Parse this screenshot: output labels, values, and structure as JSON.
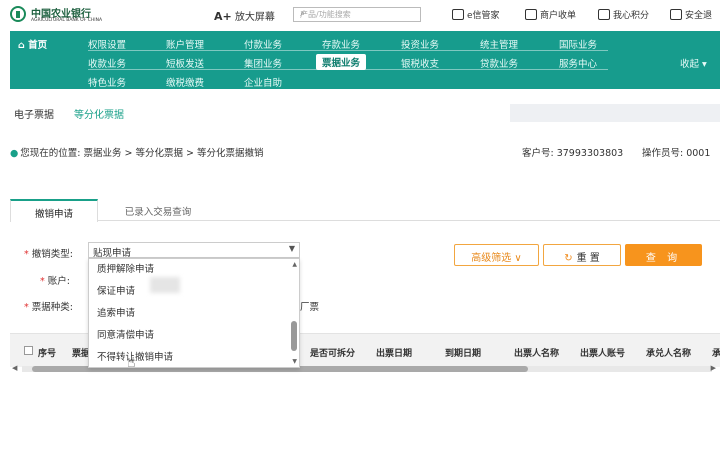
{
  "header": {
    "logo_cn": "中国农业银行",
    "logo_en": "AGRICULTURAL BANK OF CHINA",
    "zoom_prefix": "A+",
    "zoom_label": "放大屏幕",
    "search_placeholder": "产品/功能搜索",
    "links": [
      "e信管家",
      "商户收单",
      "我心积分",
      "安全退"
    ]
  },
  "nav": {
    "home": "首页",
    "row1": [
      "权限设置",
      "账户管理",
      "付款业务",
      "存款业务",
      "投资业务",
      "统主管理",
      "国际业务"
    ],
    "row2": [
      "收款业务",
      "短板发送",
      "集团业务",
      "票据业务",
      "银税收支",
      "贷款业务",
      "服务中心"
    ],
    "row3": [
      "特色业务",
      "缴税缴费",
      "企业自助"
    ],
    "right_label": "收起",
    "active": "票据业务"
  },
  "subnav": {
    "item1": "电子票据",
    "item2": "等分化票据"
  },
  "breadcrumb": "您现在的位置: 票据业务 > 等分化票据 > 等分化票据撤销",
  "customer_label": "客户号: 37993303803",
  "operator_label": "操作员号: 0001",
  "tabs": {
    "active": "撤销申请",
    "other": "已录入交易查询"
  },
  "form": {
    "req_mark": "*",
    "type_label": "撤销类型:",
    "account_label": "账户:",
    "bill_type_label": "票据种类:",
    "selected_type": "贴现申请",
    "bill_type_suffix": "厂票",
    "dropdown_options": [
      "质押解除申请",
      "保证申请",
      "追索申请",
      "同意清偿申请",
      "不得转让撤销申请"
    ]
  },
  "buttons": {
    "advanced": "高级筛选",
    "reset": "重 置",
    "query": "查 询"
  },
  "table": {
    "headers": [
      "序号",
      "票据",
      "是否可拆分",
      "出票日期",
      "到期日期",
      "出票人名称",
      "出票人账号",
      "承兑人名称",
      "承"
    ]
  }
}
